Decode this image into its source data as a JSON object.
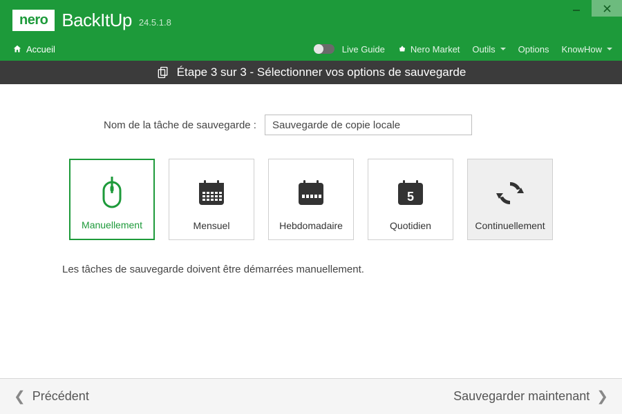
{
  "app": {
    "logo": "nero",
    "name": "BackItUp",
    "version": "24.5.1.8"
  },
  "menubar": {
    "home": "Accueil",
    "live_guide": "Live Guide",
    "market": "Nero Market",
    "tools": "Outils",
    "options": "Options",
    "knowhow": "KnowHow"
  },
  "step": {
    "title": "Étape 3 sur 3 - Sélectionner vos options de sauvegarde"
  },
  "form": {
    "name_label": "Nom de la tâche de sauvegarde :",
    "name_value": "Sauvegarde de copie locale"
  },
  "options": [
    {
      "key": "manual",
      "label": "Manuellement",
      "selected": true
    },
    {
      "key": "monthly",
      "label": "Mensuel",
      "selected": false
    },
    {
      "key": "weekly",
      "label": "Hebdomadaire",
      "selected": false
    },
    {
      "key": "daily",
      "label": "Quotidien",
      "selected": false
    },
    {
      "key": "continuous",
      "label": "Continuellement",
      "selected": false
    }
  ],
  "description": "Les tâches de sauvegarde doivent être démarrées manuellement.",
  "footer": {
    "prev": "Précédent",
    "next": "Sauvegarder maintenant"
  }
}
